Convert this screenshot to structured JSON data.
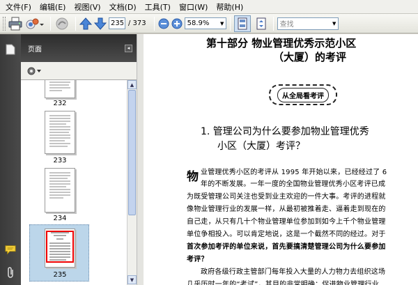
{
  "menubar": {
    "items": [
      "文件(F)",
      "编辑(E)",
      "视图(V)",
      "文档(D)",
      "工具(T)",
      "窗口(W)",
      "帮助(H)"
    ]
  },
  "toolbar": {
    "page_current": "235",
    "page_total": "/ 373",
    "zoom_value": "58.9%",
    "find_placeholder": "查找"
  },
  "nav": {
    "panel_title": "页面",
    "thumbnails": [
      {
        "label": "232",
        "selected": false
      },
      {
        "label": "233",
        "selected": false
      },
      {
        "label": "234",
        "selected": false
      },
      {
        "label": "235",
        "selected": true
      }
    ]
  },
  "document": {
    "title_line1": "第十部分  物业管理优秀示范小区",
    "title_line2": "（大厦）的考评",
    "stamp": "从全局看考评",
    "heading_line1": "1. 管理公司为什么要参加物业管理优秀",
    "heading_line2": "小区（大厦）考评？",
    "drop_cap": "物",
    "body_lines": [
      "业管理优秀小区的考评从 1995 年开始以来，已经经过了 6",
      "年的不断发展。一年一度的全国物业管理优秀小区考评已成",
      "为既受管理公司关注也受到业主欢迎的一件大事。考评的进程就",
      "像物业管理行业的发展一样，从最初被推着走、逼着走到现在的",
      "自己走，从只有几十个物业管理单位参加到如今上千个物业管理",
      "单位争相投入。可以肯定地说，这是一个截然不同的经过。对于",
      "首次参加考评的单位来说，首先要搞清楚管理公司为什么要参加",
      "考评？",
      "政府各级行政主管部门每年投入大量的人力物力去组织这场",
      "几乎历时一年的“考试”，其目的非常明确：促进物业管理行业"
    ]
  }
}
